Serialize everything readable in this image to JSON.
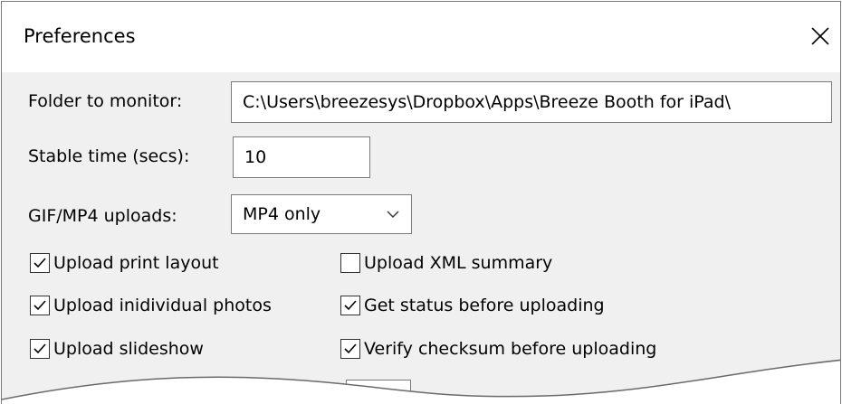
{
  "dialog": {
    "title": "Preferences",
    "close_icon": "close-icon"
  },
  "folder": {
    "label": "Folder to monitor:",
    "value": "C:\\Users\\breezesys\\Dropbox\\Apps\\Breeze Booth for iPad\\"
  },
  "stable_time": {
    "label": "Stable time (secs):",
    "value": "10"
  },
  "gif_mp4": {
    "label": "GIF/MP4 uploads:",
    "selected": "MP4 only"
  },
  "checkboxes": {
    "upload_print_layout": {
      "label": "Upload print layout",
      "checked": true
    },
    "upload_individual_photos": {
      "label": "Upload inidividual photos",
      "checked": true
    },
    "upload_slideshow": {
      "label": "Upload slideshow",
      "checked": true
    },
    "upload_xml_summary": {
      "label": "Upload XML summary",
      "checked": false
    },
    "get_status": {
      "label": "Get status before uploading",
      "checked": true
    },
    "verify_checksum": {
      "label": "Verify checksum before uploading",
      "checked": true
    }
  },
  "colors": {
    "dialog_bg": "#f0f0f0",
    "titlebar_bg": "#ffffff",
    "border": "#7a7a7a"
  }
}
